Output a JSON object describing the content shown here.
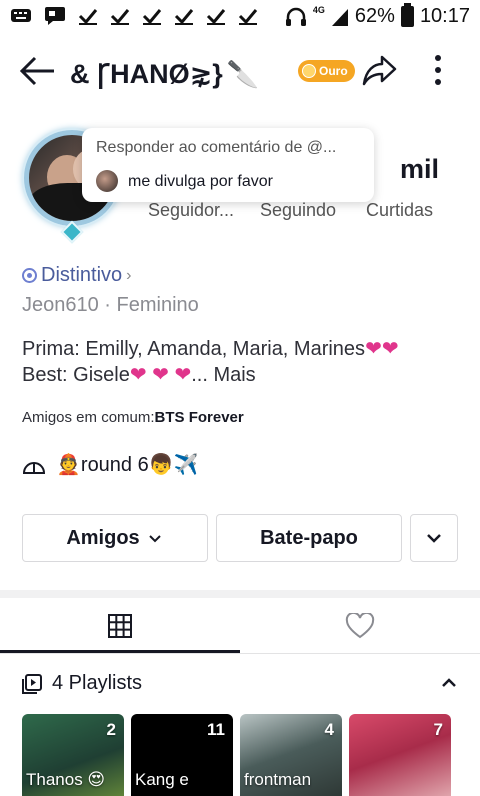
{
  "status_bar": {
    "network": "4G",
    "battery": "62%",
    "time": "10:17"
  },
  "header": {
    "title": "& ꞄHANØ⋧}",
    "title_emoji": "🔪",
    "badge": "Ouro"
  },
  "popup": {
    "title": "Responder ao comentário de @...",
    "text": "me divulga por favor"
  },
  "stats": {
    "value": "mil",
    "labels": [
      "Seguidor...",
      "Seguindo",
      "Curtidas"
    ]
  },
  "profile": {
    "distintivo": "Distintivo",
    "user_line": "Jeon610 · Feminino",
    "bio_line1": "Prima: Emilly, Amanda, Maria, Marines",
    "bio_line1_hearts": "❤❤",
    "bio_line2_prefix": "Best: Gisele",
    "bio_line2_hearts": "❤ ❤ ❤",
    "bio_line2_suffix": "...  Mais",
    "amigos_label": "Amigos em comum:",
    "amigos_value": "BTS Forever",
    "music_text": "👲round 6👦✈️"
  },
  "buttons": {
    "amigos": "Amigos",
    "chat": "Bate-papo"
  },
  "playlists": {
    "title": "4 Playlists",
    "items": [
      {
        "count": "2",
        "name": "Thanos 😍"
      },
      {
        "count": "11",
        "name": "Kang e"
      },
      {
        "count": "4",
        "name": "frontman"
      },
      {
        "count": "7",
        "name": ""
      }
    ]
  },
  "colors": {
    "accent_gold": "#f5a623",
    "heart": "#e0358c",
    "badge_blue": "#6e7fd0"
  }
}
